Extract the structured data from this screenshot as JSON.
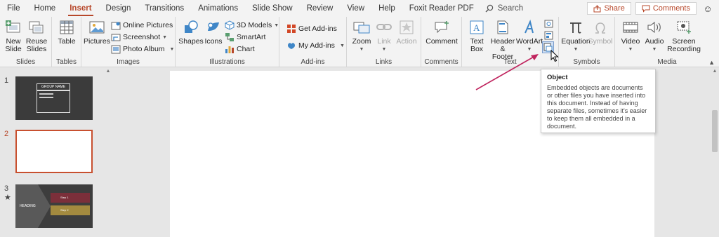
{
  "tabs": [
    "File",
    "Home",
    "Insert",
    "Design",
    "Transitions",
    "Animations",
    "Slide Show",
    "Review",
    "View",
    "Help",
    "Foxit Reader PDF"
  ],
  "active_tab": "Insert",
  "search": {
    "label": "Search"
  },
  "header_right": {
    "share": "Share",
    "comments": "Comments"
  },
  "groups": {
    "slides": {
      "label": "Slides",
      "new_slide": "New Slide",
      "reuse_slides": "Reuse Slides"
    },
    "tables": {
      "label": "Tables",
      "table": "Table"
    },
    "images": {
      "label": "Images",
      "pictures": "Pictures",
      "online_pictures": "Online Pictures",
      "screenshot": "Screenshot",
      "photo_album": "Photo Album"
    },
    "illustrations": {
      "label": "Illustrations",
      "shapes": "Shapes",
      "icons": "Icons",
      "models": "3D Models",
      "smartart": "SmartArt",
      "chart": "Chart"
    },
    "addins": {
      "label": "Add-ins",
      "get": "Get Add-ins",
      "my": "My Add-ins"
    },
    "links": {
      "label": "Links",
      "zoom": "Zoom",
      "link": "Link",
      "action": "Action"
    },
    "comments": {
      "label": "Comments",
      "comment": "Comment"
    },
    "text": {
      "label": "Text",
      "text_box": "Text Box",
      "header_footer": "Header & Footer",
      "wordart": "WordArt"
    },
    "symbols": {
      "label": "Symbols",
      "equation": "Equation",
      "symbol": "Symbol"
    },
    "media": {
      "label": "Media",
      "video": "Video",
      "audio": "Audio",
      "screen_recording": "Screen Recording"
    }
  },
  "slides": [
    {
      "number": "1",
      "title": "GROUP NAME"
    },
    {
      "number": "2"
    },
    {
      "number": "3",
      "marker": "★",
      "heading": "HEADING",
      "step1": "Step 1",
      "step2": "Step 2"
    }
  ],
  "tooltip": {
    "title": "Object",
    "body": "Embedded objects are documents or other files you have inserted into this document. Instead of having separate files, sometimes it's easier to keep them all embedded in a document."
  },
  "colors": {
    "accent": "#b7472a",
    "ribbon_bg": "#f3f3f3",
    "arrow": "#c0245e"
  }
}
